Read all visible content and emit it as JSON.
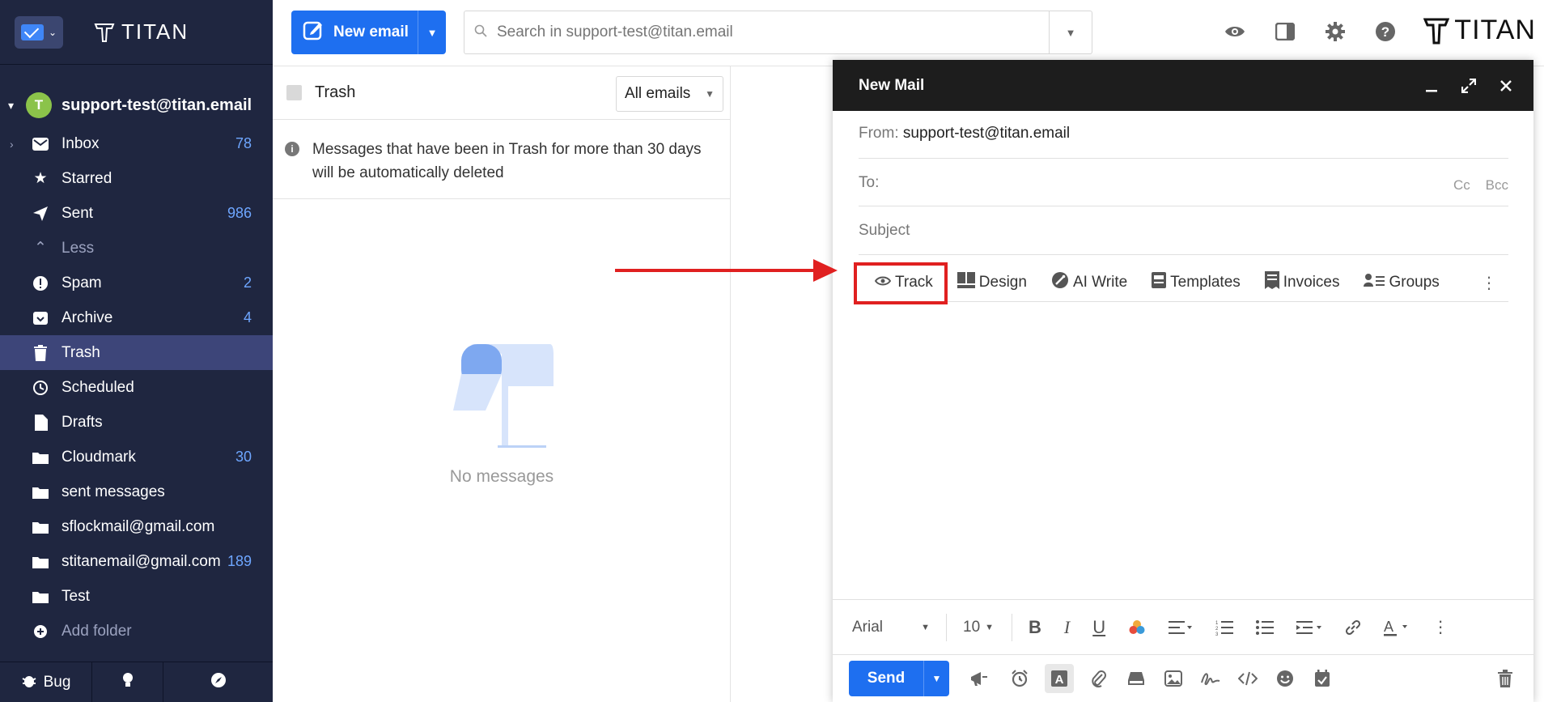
{
  "sidebar": {
    "logo": "TITAN",
    "account": {
      "initial": "T",
      "email": "support-test@titan.email"
    },
    "folders": [
      {
        "label": "Inbox",
        "count": "78"
      },
      {
        "label": "Starred",
        "count": ""
      },
      {
        "label": "Sent",
        "count": "986"
      },
      {
        "label": "Less",
        "count": ""
      },
      {
        "label": "Spam",
        "count": "2"
      },
      {
        "label": "Archive",
        "count": "4"
      },
      {
        "label": "Trash",
        "count": ""
      },
      {
        "label": "Scheduled",
        "count": ""
      },
      {
        "label": "Drafts",
        "count": ""
      },
      {
        "label": "Cloudmark",
        "count": "30"
      },
      {
        "label": "sent messages",
        "count": ""
      },
      {
        "label": "sflockmail@gmail.com",
        "count": ""
      },
      {
        "label": "stitanemail@gmail.com",
        "count": "189"
      },
      {
        "label": "Test",
        "count": ""
      },
      {
        "label": "Add folder",
        "count": ""
      }
    ],
    "bottom": {
      "bug_label": "Bug"
    }
  },
  "topbar": {
    "new_email_label": "New email",
    "search_placeholder": "Search in support-test@titan.email",
    "logo": "TITAN"
  },
  "list": {
    "folder_title": "Trash",
    "filter_value": "All emails",
    "notice": "Messages that have been in Trash for more than 30 days will be automatically deleted",
    "empty_text": "No messages"
  },
  "compose": {
    "title": "New Mail",
    "from_label": "From:",
    "from_value": "support-test@titan.email",
    "to_label": "To:",
    "cc_label": "Cc",
    "bcc_label": "Bcc",
    "subject_placeholder": "Subject",
    "tools": [
      "Track",
      "Design",
      "AI Write",
      "Templates",
      "Invoices",
      "Groups"
    ],
    "font_family": "Arial",
    "font_size": "10",
    "send_label": "Send"
  },
  "colors": {
    "sidebar_bg": "#1f2640",
    "accent": "#1e6ff0",
    "highlight": "#e02020"
  }
}
